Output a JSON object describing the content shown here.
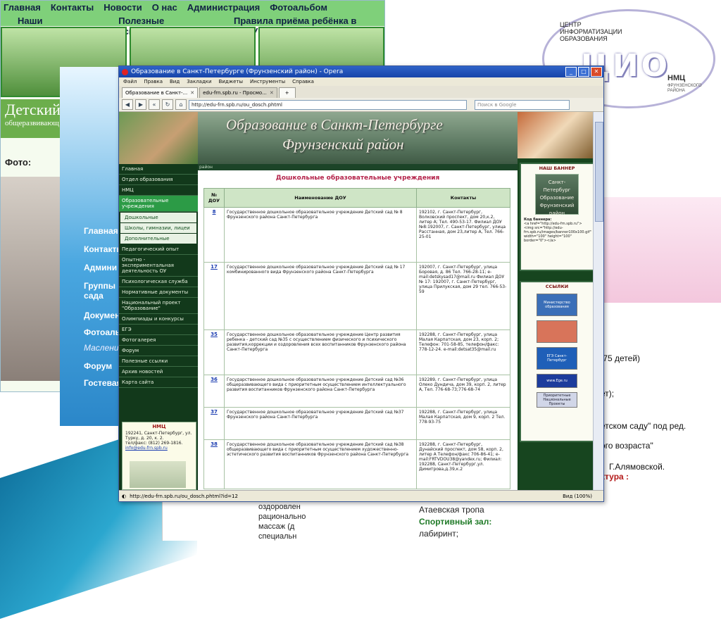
{
  "background_left": {
    "nav_row1": [
      "Главная",
      "Контакты",
      "Новости",
      "О нас",
      "Администрация",
      "Фотоальбом"
    ],
    "nav_row2": [
      "Наши педагоги",
      "Полезные ссылки",
      "Правила приёма ребёнка в ГДОУ"
    ],
    "title_fragment": "Детский",
    "subtitle_fragment": "общеразвивающ",
    "photo_label": "Фото:"
  },
  "background_blue_site": {
    "items": [
      "Главная",
      "Контакты",
      "Админи",
      "Группы сада",
      "Докумен",
      "Фотоальб",
      "Масленица",
      "Форум",
      "Гостевая"
    ]
  },
  "background_right": {
    "lines": [
      ".75 детей)",
      "ет);",
      ")",
      "етском саду\" под ред.",
      "ого возраста\"",
      "Г.Алямовской.",
      "ктура :"
    ]
  },
  "background_bottom": {
    "col1": [
      "оздоровлен",
      "рационально",
      "массаж (д",
      "специальн"
    ],
    "col2": [
      "Атаевская тропа",
      "Спортивный зал:",
      "лабиринт;"
    ]
  },
  "logo": {
    "line1": "ЦЕНТР",
    "line2": "ИНФОРМАТИЗАЦИИ",
    "line3": "ОБРАЗОВАНИЯ",
    "letters": "ЦИО",
    "nmc": "НМЦ",
    "district1": "ФРУНЗЕНСКОГО",
    "district2": "РАЙОНА"
  },
  "browser": {
    "title": "Образование в Санкт-Петербурге (Фрунзенский район) - Opera",
    "menu": [
      "Файл",
      "Правка",
      "Вид",
      "Закладки",
      "Виджеты",
      "Инструменты",
      "Справка"
    ],
    "tabs": [
      {
        "label": "Образование в Санкт-...",
        "active": true
      },
      {
        "label": "edu-frn.spb.ru - Просмо...",
        "active": false
      }
    ],
    "url": "http://edu-frn.spb.ru/ou_dosch.phtml",
    "search_placeholder": "Поиск в Google",
    "status_url": "http://edu-frn.spb.ru/ou_dosch.phtml?id=12",
    "zoom": "Вид (100%)"
  },
  "page": {
    "banner_line1": "Образование в Санкт-Петербурге",
    "banner_line2": "Фрунзенский район",
    "breadcrumb": "район",
    "heading": "Дошкольные образовательные учреждения",
    "nav": [
      {
        "label": "Главная",
        "type": "normal"
      },
      {
        "label": "Отдел образования",
        "type": "normal"
      },
      {
        "label": "НМЦ",
        "type": "normal"
      },
      {
        "label": "Образовательные учреждения",
        "type": "active"
      },
      {
        "label": "Дошкольные",
        "type": "sub"
      },
      {
        "label": "Школы, гимназии, лицеи",
        "type": "sub"
      },
      {
        "label": "Дополнительные",
        "type": "sub"
      },
      {
        "label": "Педагогический опыт",
        "type": "normal"
      },
      {
        "label": "Опытно - экспериментальная деятельность ОУ",
        "type": "normal"
      },
      {
        "label": "Психологическая служба",
        "type": "normal"
      },
      {
        "label": "Нормативные документы",
        "type": "normal"
      },
      {
        "label": "Национальный проект \"Образование\"",
        "type": "normal"
      },
      {
        "label": "Олимпиады и конкурсы",
        "type": "normal"
      },
      {
        "label": "ЕГЭ",
        "type": "normal"
      },
      {
        "label": "Фотогалерея",
        "type": "normal"
      },
      {
        "label": "Форум",
        "type": "normal"
      },
      {
        "label": "Полезные ссылки",
        "type": "normal"
      },
      {
        "label": "Архив новостей",
        "type": "normal"
      },
      {
        "label": "Карта сайта",
        "type": "normal"
      }
    ],
    "nmc_box": {
      "title": "НМЦ",
      "address": "192241, Санкт-Петербург, ул. Турку, д. 20, к. 2.",
      "phone": "тел/факс: (812) 269-1816.",
      "email": "info@edu-frn.spb.ru"
    },
    "table": {
      "headers": [
        "№ ДОУ",
        "Наименование ДОУ",
        "Контакты"
      ],
      "rows": [
        {
          "num": "8",
          "name": "Государственное дошкольное образовательное учреждение Детский сад № 8 Фрунзенского района Санкт-Петербурга",
          "contacts": "192102, г. Санкт-Петербург, Волковский проспект, дом 20,к.2, литер А; Тел. 490-53-17. Филиал ДОУ №8:192007, г. Санкт-Петербург, улица Расстанная, дом 23,литер А, Тел. 766-25-01"
        },
        {
          "num": "17",
          "name": "Государственное дошкольное образовательное учреждение Детский сад № 17 комбинированного вида Фрунзенского района Санкт-Петербурга",
          "contacts": "192007, г. Санкт-Петербург, улица Боровая, д. 86 Тел. 766-28-11; e-mail:detskysad17@mail.ru Филиал ДОУ № 17: 192007, г. Санкт-Петербург, улица Прилукская, дом 29 тел. 766-53-59"
        },
        {
          "num": "35",
          "name": "Государственное дошкольное образовательное учреждение Центр развития ребенка - детский сад №35 с осуществлением физического и психического развития,коррекции и оздоровления всех воспитанников Фрунзенского района Санкт-Петербурга",
          "contacts": "192288, г. Санкт-Петербург, улица Малая Карпатская, дом 23, корп. 2; Телефон: 701-58-85, телефон/факс: 778-12-24. e-mail:detsat35@mail.ru"
        },
        {
          "num": "36",
          "name": "Государственное дошкольное образовательное учреждение Детский сад №36 общеразвивающего вида с приоритетным осуществлением интеллектуального развития воспитанников Фрунзенского района Санкт-Петербурга",
          "contacts": "192289, г. Санкт-Петербург, улица Олеко Дундича, дом 39, корп. 2, литер А, Тел. 776-68-73;776-68-74"
        },
        {
          "num": "37",
          "name": "Государственное дошкольное образовательное учреждение Детский сад №37 Фрунзенского района Санкт-Петербурга",
          "contacts": "192288, г. Санкт-Петербург, улица Малая Карпатская, дом 9, корп. 2 Тел. 778-93-75"
        },
        {
          "num": "38",
          "name": "Государственное дошкольное образовательное учреждение Детский сад №38 общеразвивающего вида с приоритетным осуществлением художественно-эстетического развития воспитанников Фрунзенского района Санкт-Петербурга",
          "contacts": "192288, г. Санкт-Петербург, Дунайский проспект, дом 58, корп. 2, литер А Телефон/факс 706-86-41; e-mail:FRTVDOU38@yandex.ru; Филиал: 192288, Санкт-Петербург,ул. Димитрова,д.39,к.2"
        }
      ]
    },
    "right": {
      "banner_title": "НАШ БАННЕР",
      "banner_text": "Санкт-Петербург Образование Фрунзенский район",
      "code_title": "Код баннера:",
      "code": "<a href=\"http://edu-frn.spb.ru\"><img src=\"http://edu-frn.spb.ru/images/banner100x100.gif\" width=\"100\" height=\"100\" border=\"0\"></a>",
      "links_title": "ССЫЛКИ",
      "links": [
        "Министерство образования",
        "",
        "ЕГЭ Санкт-Петербург",
        "www.Ege.ru",
        "Приоритетные Национальные Проекты"
      ]
    }
  }
}
